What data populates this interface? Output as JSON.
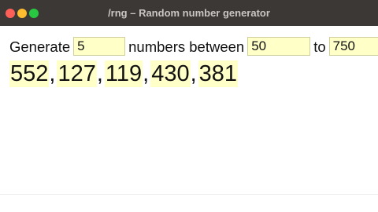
{
  "window": {
    "title": "/rng – Random number generator"
  },
  "form": {
    "generate_label": "Generate",
    "count_value": "5",
    "numbers_between_label": "numbers between",
    "min_value": "50",
    "to_label": "to",
    "max_value": "750"
  },
  "results": {
    "numbers": [
      "552",
      "127",
      "119",
      "430",
      "381"
    ],
    "separator": ","
  },
  "colors": {
    "titlebar": "#3b3836",
    "field_highlight": "#ffffc8",
    "close": "#fe5f57",
    "minimize": "#febc2e",
    "maximize": "#28c840"
  }
}
